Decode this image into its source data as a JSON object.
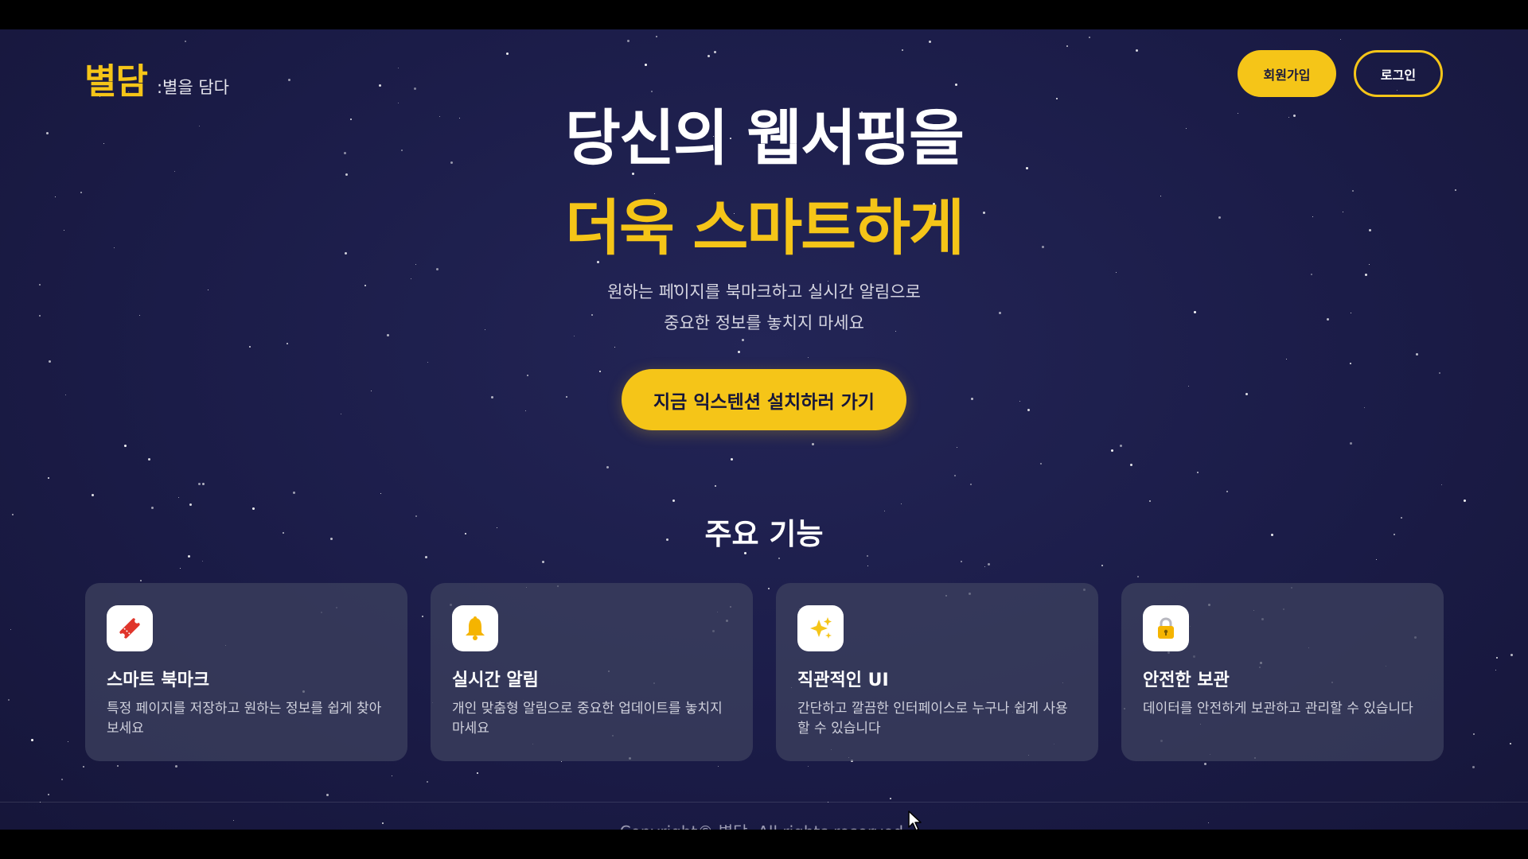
{
  "brand": {
    "logo": "별담",
    "tagline": ":별을 담다"
  },
  "nav": {
    "signup_label": "회원가입",
    "login_label": "로그인"
  },
  "hero": {
    "line1": "당신의 웹서핑을",
    "line2": "더욱 스마트하게",
    "sub1": "원하는 페이지를 북마크하고 실시간 알림으로",
    "sub2": "중요한 정보를 놓치지 마세요",
    "cta_label": "지금 익스텐션 설치하러 가기"
  },
  "features": {
    "title": "주요 기능",
    "cards": [
      {
        "icon": "bookmark-ticket-icon",
        "title": "스마트 북마크",
        "desc": "특정 페이지를 저장하고 원하는 정보를 쉽게 찾아보세요"
      },
      {
        "icon": "bell-icon",
        "title": "실시간 알림",
        "desc": "개인 맞춤형 알림으로 중요한 업데이트를 놓치지 마세요"
      },
      {
        "icon": "sparkles-icon",
        "title": "직관적인 UI",
        "desc": "간단하고 깔끔한 인터페이스로 누구나 쉽게 사용할 수 있습니다"
      },
      {
        "icon": "lock-icon",
        "title": "안전한 보관",
        "desc": "데이터를 안전하게 보관하고 관리할 수 있습니다"
      }
    ]
  },
  "footer": {
    "copyright": "Copyright© 별담. All rights reserved."
  },
  "colors": {
    "accent": "#f5c518",
    "background": "#1b1c48",
    "card": "#3e4260"
  }
}
